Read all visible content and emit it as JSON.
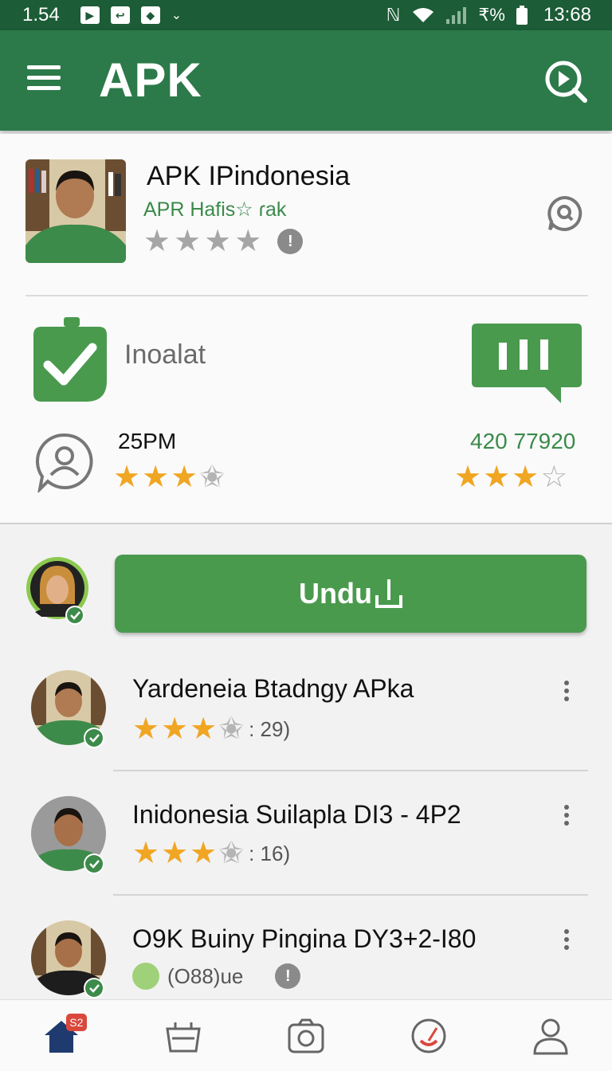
{
  "status_bar": {
    "time": "1.54",
    "battery_text": "₹%",
    "clock": "13:68"
  },
  "app_bar": {
    "title": "APK"
  },
  "app_header": {
    "name": "APK IPindonesia",
    "subtitle": "APR Hafis☆ ɾak",
    "gray_star_count": 4,
    "info_icon": "info-icon"
  },
  "install": {
    "label": "Inoalat"
  },
  "ratings": {
    "left_value": "25PM",
    "left_stars": 3.5,
    "right_value": "420 77920",
    "right_stars": 3
  },
  "download": {
    "label": "Undu"
  },
  "list": [
    {
      "title": "Yardeneia Btadngy APka",
      "stars": 3.5,
      "count": ": 29)"
    },
    {
      "title": "Inidonesia Suilapla DI3 - 4P2",
      "stars": 3.5,
      "count": ": 16)"
    },
    {
      "title": "O9K Buiny Pingina DY3+2-I80",
      "meta": "(O88)ue"
    }
  ],
  "bottom_nav": {
    "home_badge": "S2"
  },
  "colors": {
    "primary": "#2c7a4a",
    "status_bar": "#1c5c37",
    "accent_green": "#4a9a4e",
    "star": "#f0a623"
  }
}
